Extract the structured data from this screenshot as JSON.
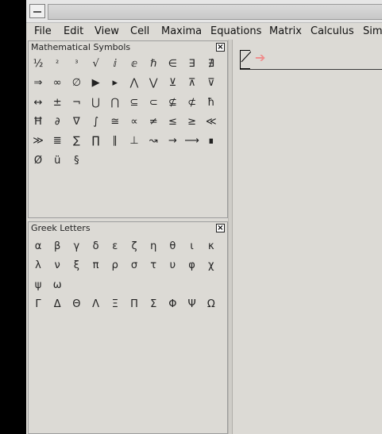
{
  "menu": [
    "File",
    "Edit",
    "View",
    "Cell",
    "Maxima",
    "Equations",
    "Matrix",
    "Calculus",
    "Sim"
  ],
  "math_panel": {
    "title": "Mathematical Symbols",
    "close": "×",
    "symbols": [
      "½",
      "²",
      "³",
      "√",
      "ⅈ",
      "ⅇ",
      "ℏ",
      "∈",
      "∃",
      "∄",
      "⇒",
      "∞",
      "∅",
      "▶",
      "▸",
      "⋀",
      "⋁",
      "⊻",
      "⊼",
      "⊽",
      "↔",
      "±",
      "¬",
      "⋃",
      "⋂",
      "⊆",
      "⊂",
      "⊈",
      "⊄",
      "ħ",
      "Ħ",
      "∂",
      "∇",
      "∫",
      "≅",
      "∝",
      "≠",
      "≤",
      "≥",
      "≪",
      "≫",
      "≣",
      "∑",
      "∏",
      "∥",
      "⊥",
      "↝",
      "→",
      "⟶",
      "∎",
      "Ø",
      "ü",
      "§"
    ]
  },
  "greek_panel": {
    "title": "Greek Letters",
    "close": "×",
    "letters": [
      "α",
      "β",
      "γ",
      "δ",
      "ε",
      "ζ",
      "η",
      "θ",
      "ι",
      "κ",
      "λ",
      "ν",
      "ξ",
      "π",
      "ρ",
      "σ",
      "τ",
      "υ",
      "φ",
      "χ",
      "ψ",
      "ω",
      "Γ",
      "Δ",
      "Θ",
      "Λ",
      "Ξ",
      "Π",
      "Σ",
      "Φ",
      "Ψ",
      "Ω"
    ]
  },
  "worksheet": {
    "prompt_arrow": "➔"
  }
}
